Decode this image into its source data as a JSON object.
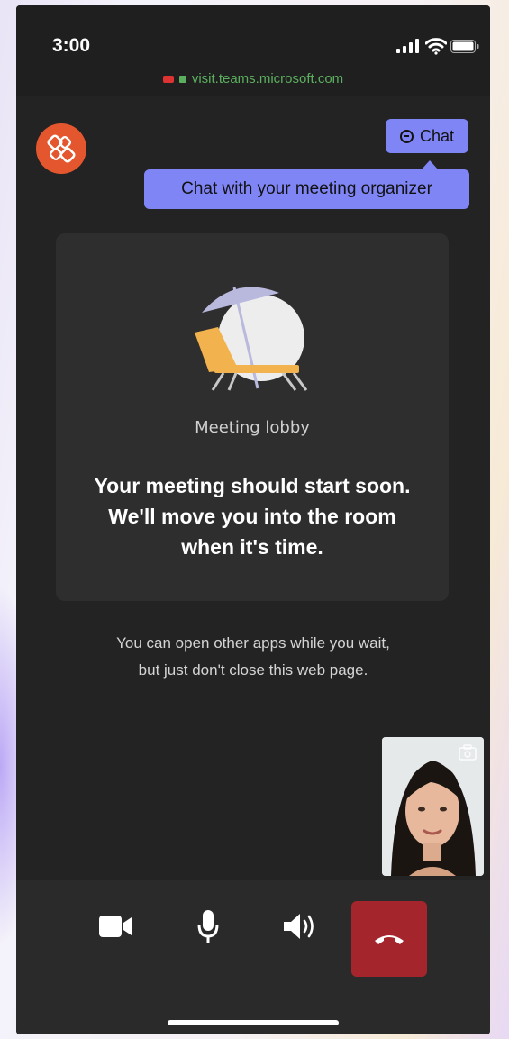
{
  "status_bar": {
    "time": "3:00",
    "url": "visit.teams.microsoft.com",
    "icons": [
      "camera-recording-icon",
      "lock-icon",
      "signal-icon",
      "wifi-icon",
      "battery-icon"
    ]
  },
  "header": {
    "logo_icon": "org-logo-icon",
    "chat_button_label": "Chat",
    "chat_tooltip": "Chat with your meeting organizer"
  },
  "lobby": {
    "illustration": "beach-chair-umbrella-illustration",
    "label": "Meeting lobby",
    "message": "Your meeting should start soon.\nWe'll move you into the room\nwhen it's time."
  },
  "note": "You can open other apps while you wait,\nbut just don't close this web page.",
  "self_view": {
    "icon": "camera-switch-icon"
  },
  "controls": {
    "items": [
      "camera-icon",
      "microphone-icon",
      "speaker-icon",
      "hang-up-icon"
    ]
  },
  "colors": {
    "accent": "#7f85f5",
    "background": "#232323",
    "card": "#2e2e2e",
    "hangup": "#a4262c",
    "logo": "#e4572e",
    "url_green": "#5cae5f"
  }
}
